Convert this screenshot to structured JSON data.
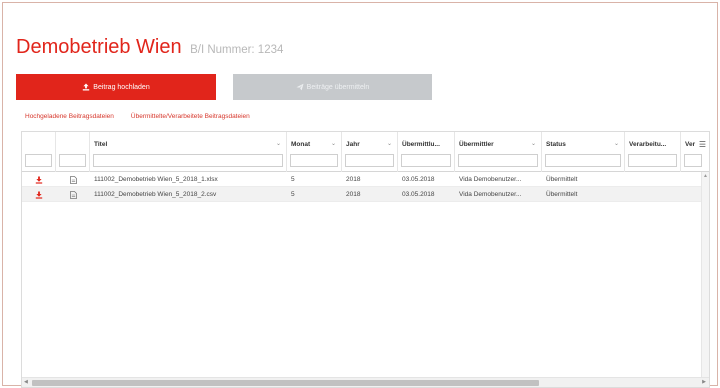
{
  "header": {
    "title": "Demobetrieb Wien",
    "subtitle": "B/I Nummer: 1234"
  },
  "toolbar": {
    "upload_label": "Beitrag hochladen",
    "send_label": "Beiträge übermitteln"
  },
  "tabs": [
    {
      "label": "Hochgeladene Beitragsdateien"
    },
    {
      "label": "Übermittelte/Verarbeitete Beitragsdateien"
    }
  ],
  "table": {
    "columns": [
      {
        "label": "Titel"
      },
      {
        "label": "Monat"
      },
      {
        "label": "Jahr"
      },
      {
        "label": "Übermittlu..."
      },
      {
        "label": "Übermittler"
      },
      {
        "label": "Status"
      },
      {
        "label": "Verarbeitu..."
      },
      {
        "label": "Ver"
      }
    ],
    "rows": [
      {
        "titel": "111002_Demobetrieb Wien_5_2018_1.xlsx",
        "monat": "5",
        "jahr": "2018",
        "datum": "03.05.2018",
        "uebermittler": "Vida Demobenutzer...",
        "status": "Übermittelt"
      },
      {
        "titel": "111002_Demobetrieb Wien_5_2018_2.csv",
        "monat": "5",
        "jahr": "2018",
        "datum": "03.05.2018",
        "uebermittler": "Vida Demobenutzer...",
        "status": "Übermittelt"
      }
    ]
  },
  "colors": {
    "accent": "#e1251b",
    "disabled": "#c6c9cc"
  }
}
